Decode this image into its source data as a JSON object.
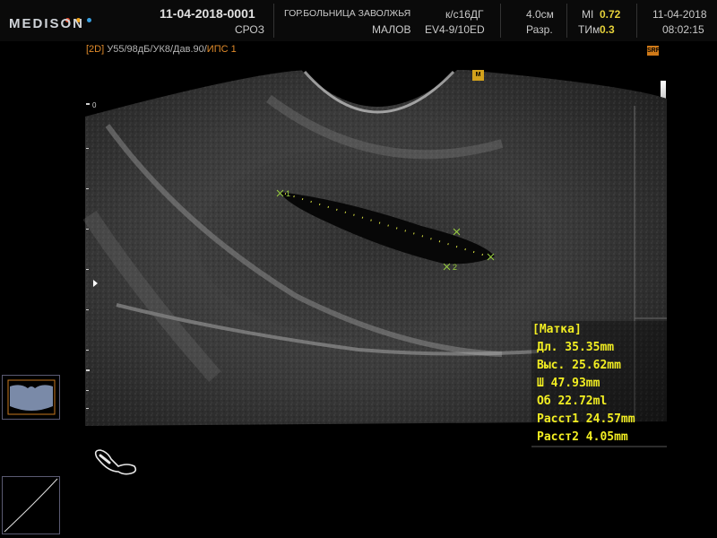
{
  "header": {
    "brand": "MEDISON",
    "brand_dot_colors": [
      "#e84a2a",
      "#f0a21a",
      "#3aa0e0"
    ],
    "patient_id": "11-04-2018-0001",
    "patient_name": "СРОЗ",
    "hospital": "ГОР.БОЛЬНИЦА ЗАВОЛЖЬЯ",
    "operator": "МАЛОВ",
    "app": "к/с16ДГ",
    "probe": "EV4-9/10ED",
    "depth_value": "4.0см",
    "resolution_label": "Разр.",
    "mi_label": "MI",
    "mi_value": "0.72",
    "tim_label": "ТИм",
    "tim_value": "0.3",
    "date": "11-04-2018",
    "time": "08:02:15"
  },
  "params": {
    "mode": "[2D]",
    "values": "У55/98дБ/УК8/Дав.90/",
    "ips": "ИПС 1"
  },
  "badges": {
    "srf": "SRF",
    "marker": "M"
  },
  "ruler": {
    "zero_label": "0"
  },
  "caliper": {
    "label1": "1",
    "label2": "2"
  },
  "measurements": {
    "title": "[Матка]",
    "rows": [
      "Дл. 35.35mm",
      "Выс. 25.62mm",
      "Ш   47.93mm",
      "Об  22.72ml",
      "Расст1 24.57mm",
      "Расст2 4.05mm"
    ]
  },
  "colors": {
    "measurement_text": "#f2ee22",
    "caliper": "#d8e040",
    "accent_orange": "#e08a2a"
  },
  "icons": {
    "probe_position": "transvaginal-probe-icon",
    "body_marker": "pelvis-body-marker-icon",
    "gray_curve": "gray-map-curve-icon"
  }
}
